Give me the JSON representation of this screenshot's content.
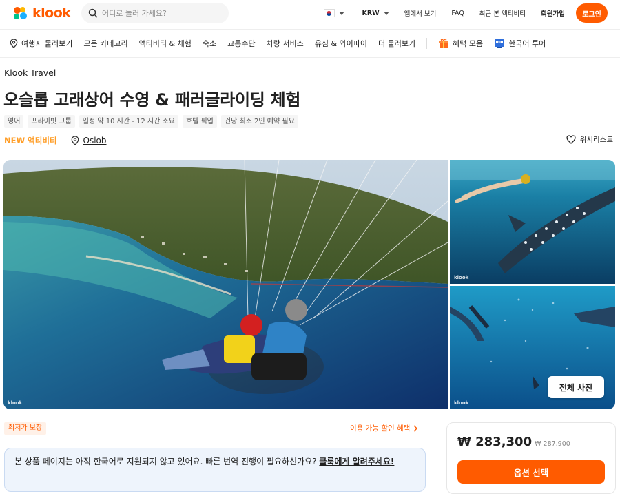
{
  "header": {
    "logo_text": "klook",
    "search_placeholder": "어디로 놀러 가세요?",
    "currency": "KRW",
    "links": [
      "앱에서 보기",
      "FAQ",
      "최근 본 액티비티",
      "회원가입"
    ],
    "login_label": "로그인",
    "language_flag": "south-korea-flag"
  },
  "nav": {
    "items": [
      {
        "label": "여행지 둘러보기",
        "icon": "location-pin-icon"
      },
      {
        "label": "모든 카테고리"
      },
      {
        "label": "액티비티 & 체험"
      },
      {
        "label": "숙소"
      },
      {
        "label": "교통수단"
      },
      {
        "label": "차량 서비스"
      },
      {
        "label": "유심 & 와이파이"
      },
      {
        "label": "더 둘러보기"
      }
    ],
    "promo_items": [
      {
        "label": "혜택 모음",
        "icon": "gift-icon"
      },
      {
        "label": "한국어 투어",
        "icon": "kr-tour-icon"
      }
    ]
  },
  "product": {
    "breadcrumb": "Klook Travel",
    "title": "오슬롭 고래상어 수영 & 패러글라이딩 체험",
    "tags": [
      "영어",
      "프라이빗 그룹",
      "일정 약 10 시간 - 12 시간 소요",
      "호텔 픽업",
      "건당 최소 2인 예약 필요"
    ],
    "badge": "NEW 액티비티",
    "location": "Oslob",
    "wishlist_label": "위시리스트"
  },
  "gallery": {
    "watermark": "klook",
    "all_photos_label": "전체 사진"
  },
  "offers": {
    "best_price_badge": "최저가 보장",
    "discount_link": "이용 가능 할인 혜택"
  },
  "notice": {
    "text": "본 상품 페이지는 아직 한국어로 지원되지 않고 있어요. 빠른 번역 진행이 필요하신가요? ",
    "link": "클룩에게 알려주세요!"
  },
  "pricing": {
    "current": "₩ 283,300",
    "original": "₩ 287,900",
    "option_button": "옵션 선택"
  },
  "colors": {
    "brand": "#ff5b00",
    "new_badge": "#ff9d26",
    "notice_bg": "#eef4fc"
  }
}
